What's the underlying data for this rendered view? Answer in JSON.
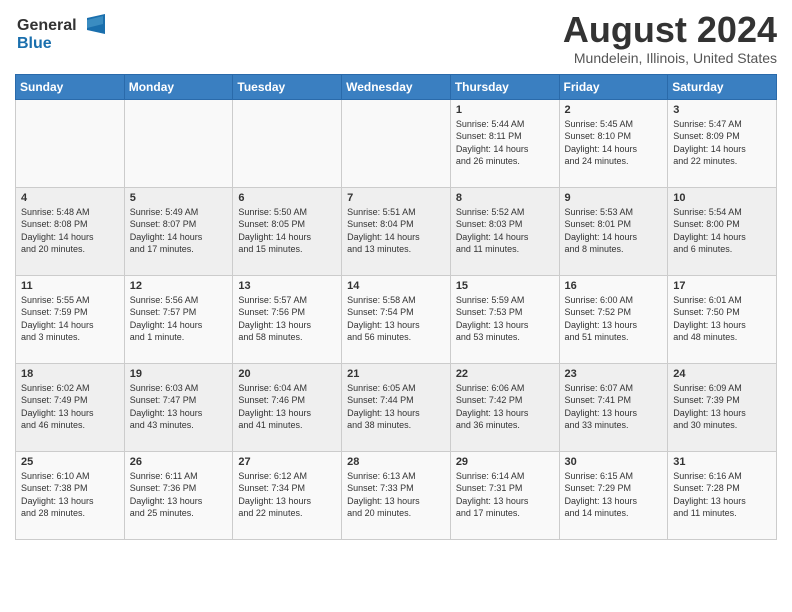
{
  "header": {
    "logo_general": "General",
    "logo_blue": "Blue",
    "month_year": "August 2024",
    "location": "Mundelein, Illinois, United States"
  },
  "days_of_week": [
    "Sunday",
    "Monday",
    "Tuesday",
    "Wednesday",
    "Thursday",
    "Friday",
    "Saturday"
  ],
  "weeks": [
    [
      {
        "day": "",
        "info": ""
      },
      {
        "day": "",
        "info": ""
      },
      {
        "day": "",
        "info": ""
      },
      {
        "day": "",
        "info": ""
      },
      {
        "day": "1",
        "info": "Sunrise: 5:44 AM\nSunset: 8:11 PM\nDaylight: 14 hours\nand 26 minutes."
      },
      {
        "day": "2",
        "info": "Sunrise: 5:45 AM\nSunset: 8:10 PM\nDaylight: 14 hours\nand 24 minutes."
      },
      {
        "day": "3",
        "info": "Sunrise: 5:47 AM\nSunset: 8:09 PM\nDaylight: 14 hours\nand 22 minutes."
      }
    ],
    [
      {
        "day": "4",
        "info": "Sunrise: 5:48 AM\nSunset: 8:08 PM\nDaylight: 14 hours\nand 20 minutes."
      },
      {
        "day": "5",
        "info": "Sunrise: 5:49 AM\nSunset: 8:07 PM\nDaylight: 14 hours\nand 17 minutes."
      },
      {
        "day": "6",
        "info": "Sunrise: 5:50 AM\nSunset: 8:05 PM\nDaylight: 14 hours\nand 15 minutes."
      },
      {
        "day": "7",
        "info": "Sunrise: 5:51 AM\nSunset: 8:04 PM\nDaylight: 14 hours\nand 13 minutes."
      },
      {
        "day": "8",
        "info": "Sunrise: 5:52 AM\nSunset: 8:03 PM\nDaylight: 14 hours\nand 11 minutes."
      },
      {
        "day": "9",
        "info": "Sunrise: 5:53 AM\nSunset: 8:01 PM\nDaylight: 14 hours\nand 8 minutes."
      },
      {
        "day": "10",
        "info": "Sunrise: 5:54 AM\nSunset: 8:00 PM\nDaylight: 14 hours\nand 6 minutes."
      }
    ],
    [
      {
        "day": "11",
        "info": "Sunrise: 5:55 AM\nSunset: 7:59 PM\nDaylight: 14 hours\nand 3 minutes."
      },
      {
        "day": "12",
        "info": "Sunrise: 5:56 AM\nSunset: 7:57 PM\nDaylight: 14 hours\nand 1 minute."
      },
      {
        "day": "13",
        "info": "Sunrise: 5:57 AM\nSunset: 7:56 PM\nDaylight: 13 hours\nand 58 minutes."
      },
      {
        "day": "14",
        "info": "Sunrise: 5:58 AM\nSunset: 7:54 PM\nDaylight: 13 hours\nand 56 minutes."
      },
      {
        "day": "15",
        "info": "Sunrise: 5:59 AM\nSunset: 7:53 PM\nDaylight: 13 hours\nand 53 minutes."
      },
      {
        "day": "16",
        "info": "Sunrise: 6:00 AM\nSunset: 7:52 PM\nDaylight: 13 hours\nand 51 minutes."
      },
      {
        "day": "17",
        "info": "Sunrise: 6:01 AM\nSunset: 7:50 PM\nDaylight: 13 hours\nand 48 minutes."
      }
    ],
    [
      {
        "day": "18",
        "info": "Sunrise: 6:02 AM\nSunset: 7:49 PM\nDaylight: 13 hours\nand 46 minutes."
      },
      {
        "day": "19",
        "info": "Sunrise: 6:03 AM\nSunset: 7:47 PM\nDaylight: 13 hours\nand 43 minutes."
      },
      {
        "day": "20",
        "info": "Sunrise: 6:04 AM\nSunset: 7:46 PM\nDaylight: 13 hours\nand 41 minutes."
      },
      {
        "day": "21",
        "info": "Sunrise: 6:05 AM\nSunset: 7:44 PM\nDaylight: 13 hours\nand 38 minutes."
      },
      {
        "day": "22",
        "info": "Sunrise: 6:06 AM\nSunset: 7:42 PM\nDaylight: 13 hours\nand 36 minutes."
      },
      {
        "day": "23",
        "info": "Sunrise: 6:07 AM\nSunset: 7:41 PM\nDaylight: 13 hours\nand 33 minutes."
      },
      {
        "day": "24",
        "info": "Sunrise: 6:09 AM\nSunset: 7:39 PM\nDaylight: 13 hours\nand 30 minutes."
      }
    ],
    [
      {
        "day": "25",
        "info": "Sunrise: 6:10 AM\nSunset: 7:38 PM\nDaylight: 13 hours\nand 28 minutes."
      },
      {
        "day": "26",
        "info": "Sunrise: 6:11 AM\nSunset: 7:36 PM\nDaylight: 13 hours\nand 25 minutes."
      },
      {
        "day": "27",
        "info": "Sunrise: 6:12 AM\nSunset: 7:34 PM\nDaylight: 13 hours\nand 22 minutes."
      },
      {
        "day": "28",
        "info": "Sunrise: 6:13 AM\nSunset: 7:33 PM\nDaylight: 13 hours\nand 20 minutes."
      },
      {
        "day": "29",
        "info": "Sunrise: 6:14 AM\nSunset: 7:31 PM\nDaylight: 13 hours\nand 17 minutes."
      },
      {
        "day": "30",
        "info": "Sunrise: 6:15 AM\nSunset: 7:29 PM\nDaylight: 13 hours\nand 14 minutes."
      },
      {
        "day": "31",
        "info": "Sunrise: 6:16 AM\nSunset: 7:28 PM\nDaylight: 13 hours\nand 11 minutes."
      }
    ]
  ]
}
